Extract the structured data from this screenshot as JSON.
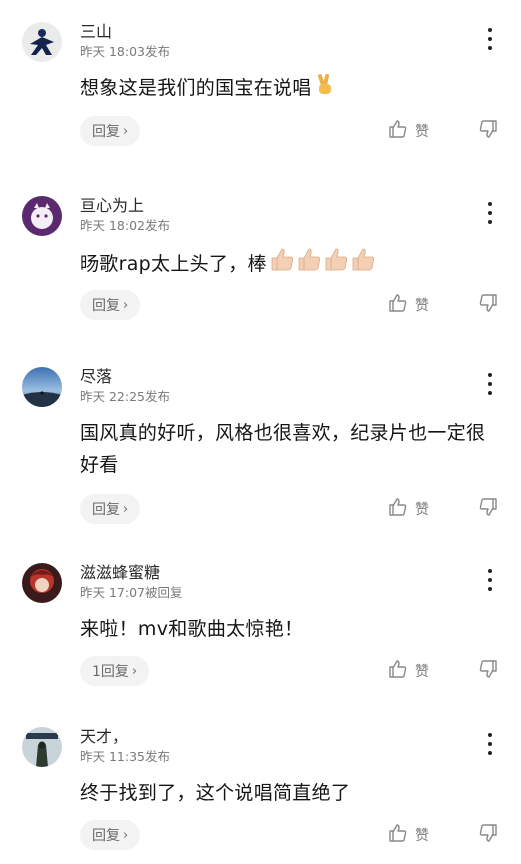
{
  "comments": [
    {
      "name": "三山",
      "meta": "昨天 18:03发布",
      "text": "想象这是我们的国宝在说唱",
      "emoji": "victory",
      "reply": "回复",
      "like": "赞"
    },
    {
      "name": "亘心为上",
      "meta": "昨天 18:02发布",
      "text": "旸歌rap太上头了，棒",
      "emoji": "thumbs4",
      "reply": "回复",
      "like": "赞"
    },
    {
      "name": "尽落",
      "meta": "昨天 22:25发布",
      "text": "国风真的好听，风格也很喜欢，纪录片也一定很好看",
      "emoji": "",
      "reply": "回复",
      "like": "赞"
    },
    {
      "name": "滋滋蜂蜜糖",
      "meta": "昨天 17:07被回复",
      "text": "来啦！mv和歌曲太惊艳！",
      "emoji": "",
      "reply": "1回复",
      "like": "赞"
    },
    {
      "name": "天才，",
      "meta": "昨天 11:35发布",
      "text": "终于找到了，这个说唱简直绝了",
      "emoji": "",
      "reply": "回复",
      "like": "赞"
    }
  ],
  "icons": {
    "more": "more-vertical-icon",
    "like": "thumbs-up-outline-icon",
    "dislike": "thumbs-down-outline-icon",
    "chevron": "›"
  }
}
